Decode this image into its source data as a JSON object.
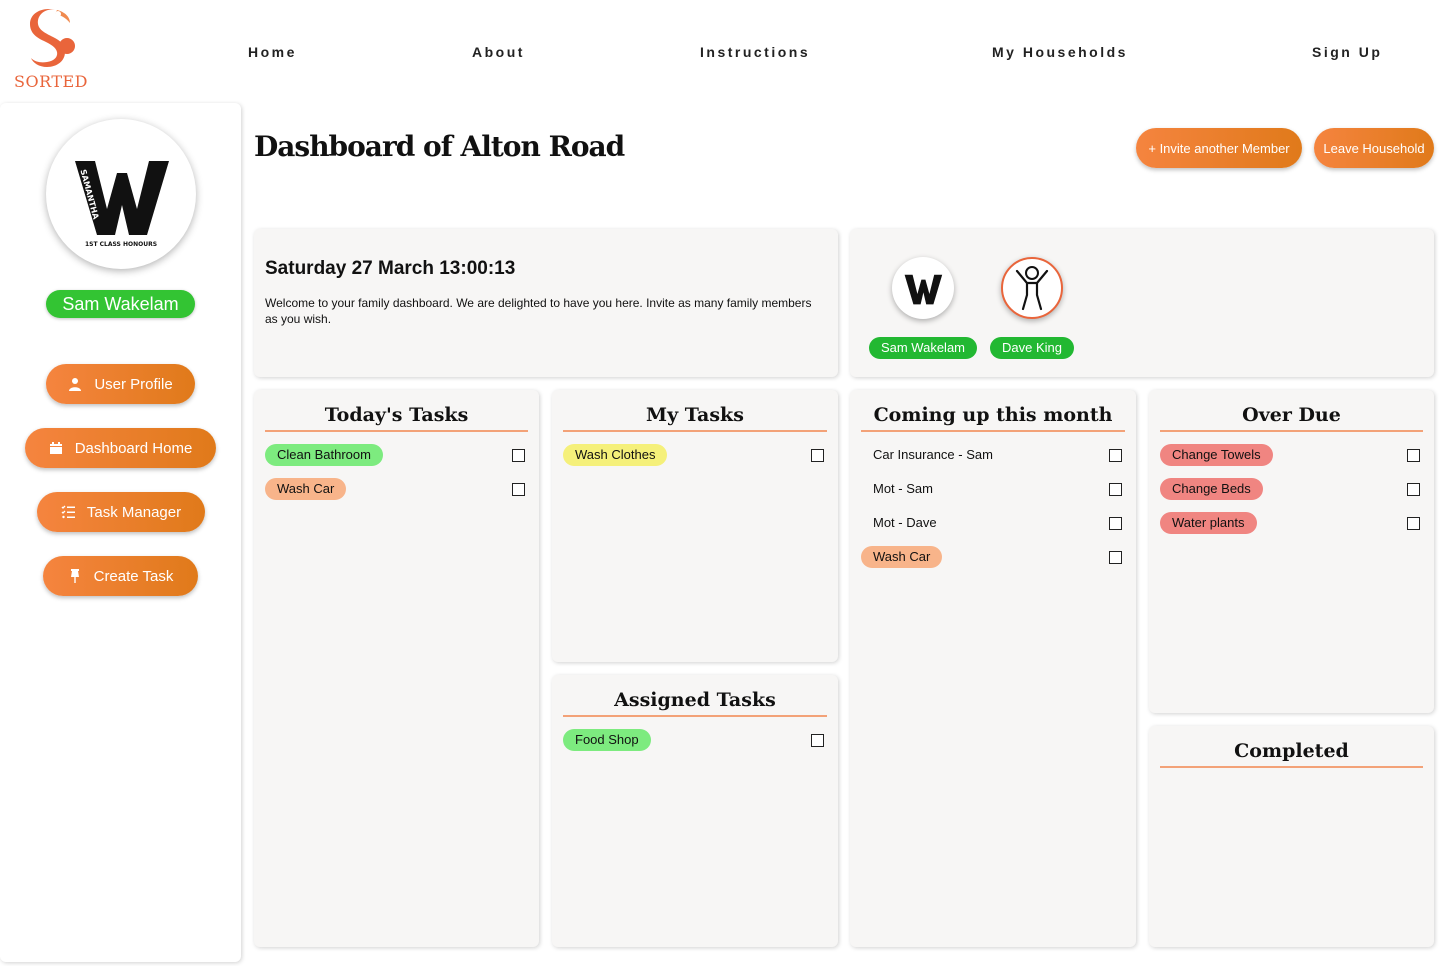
{
  "brand": {
    "name": "SORTED",
    "color": "#e9653b"
  },
  "nav": {
    "home": "Home",
    "about": "About",
    "instructions": "Instructions",
    "households": "My Households",
    "signup": "Sign Up"
  },
  "sidebar": {
    "user_name": "Sam Wakelam",
    "buttons": {
      "profile": "User Profile",
      "dashboard": "Dashboard Home",
      "task_manager": "Task Manager",
      "create_task": "Create Task"
    }
  },
  "header": {
    "title": "Dashboard of Alton Road",
    "invite_label": "+ Invite another Member",
    "leave_label": "Leave Household"
  },
  "welcome": {
    "datetime": "Saturday 27 March 13:00:13",
    "message": "Welcome to your family dashboard. We are delighted to have you here. Invite as many family members as you wish."
  },
  "members": [
    "Sam Wakelam",
    "Dave King"
  ],
  "avatar_text": {
    "name": "SAMANTHA",
    "caption": "1ST CLASS HONOURS",
    "initial": "W"
  },
  "cards": {
    "today": {
      "title": "Today's Tasks",
      "tasks": [
        "Clean Bathroom",
        "Wash Car"
      ]
    },
    "mine": {
      "title": "My Tasks",
      "tasks": [
        "Wash Clothes"
      ]
    },
    "assigned": {
      "title": "Assigned Tasks",
      "tasks": [
        "Food Shop"
      ]
    },
    "month": {
      "title": "Coming up this month",
      "tasks": [
        "Car Insurance - Sam",
        "Mot - Sam",
        "Mot - Dave",
        "Wash Car"
      ]
    },
    "overdue": {
      "title": "Over Due",
      "tasks": [
        "Change Towels",
        "Change Beds",
        "Water plants"
      ]
    },
    "completed": {
      "title": "Completed"
    }
  },
  "colors": {
    "accent": "#f5843f",
    "member_pill": "#22b832",
    "tag_green": "#7deb7f",
    "tag_peach": "#f8b48a",
    "tag_yellow": "#f5f07a",
    "tag_red": "#f08581"
  },
  "icons": [
    "user-icon",
    "calendar-icon",
    "list-icon",
    "pin-icon"
  ]
}
